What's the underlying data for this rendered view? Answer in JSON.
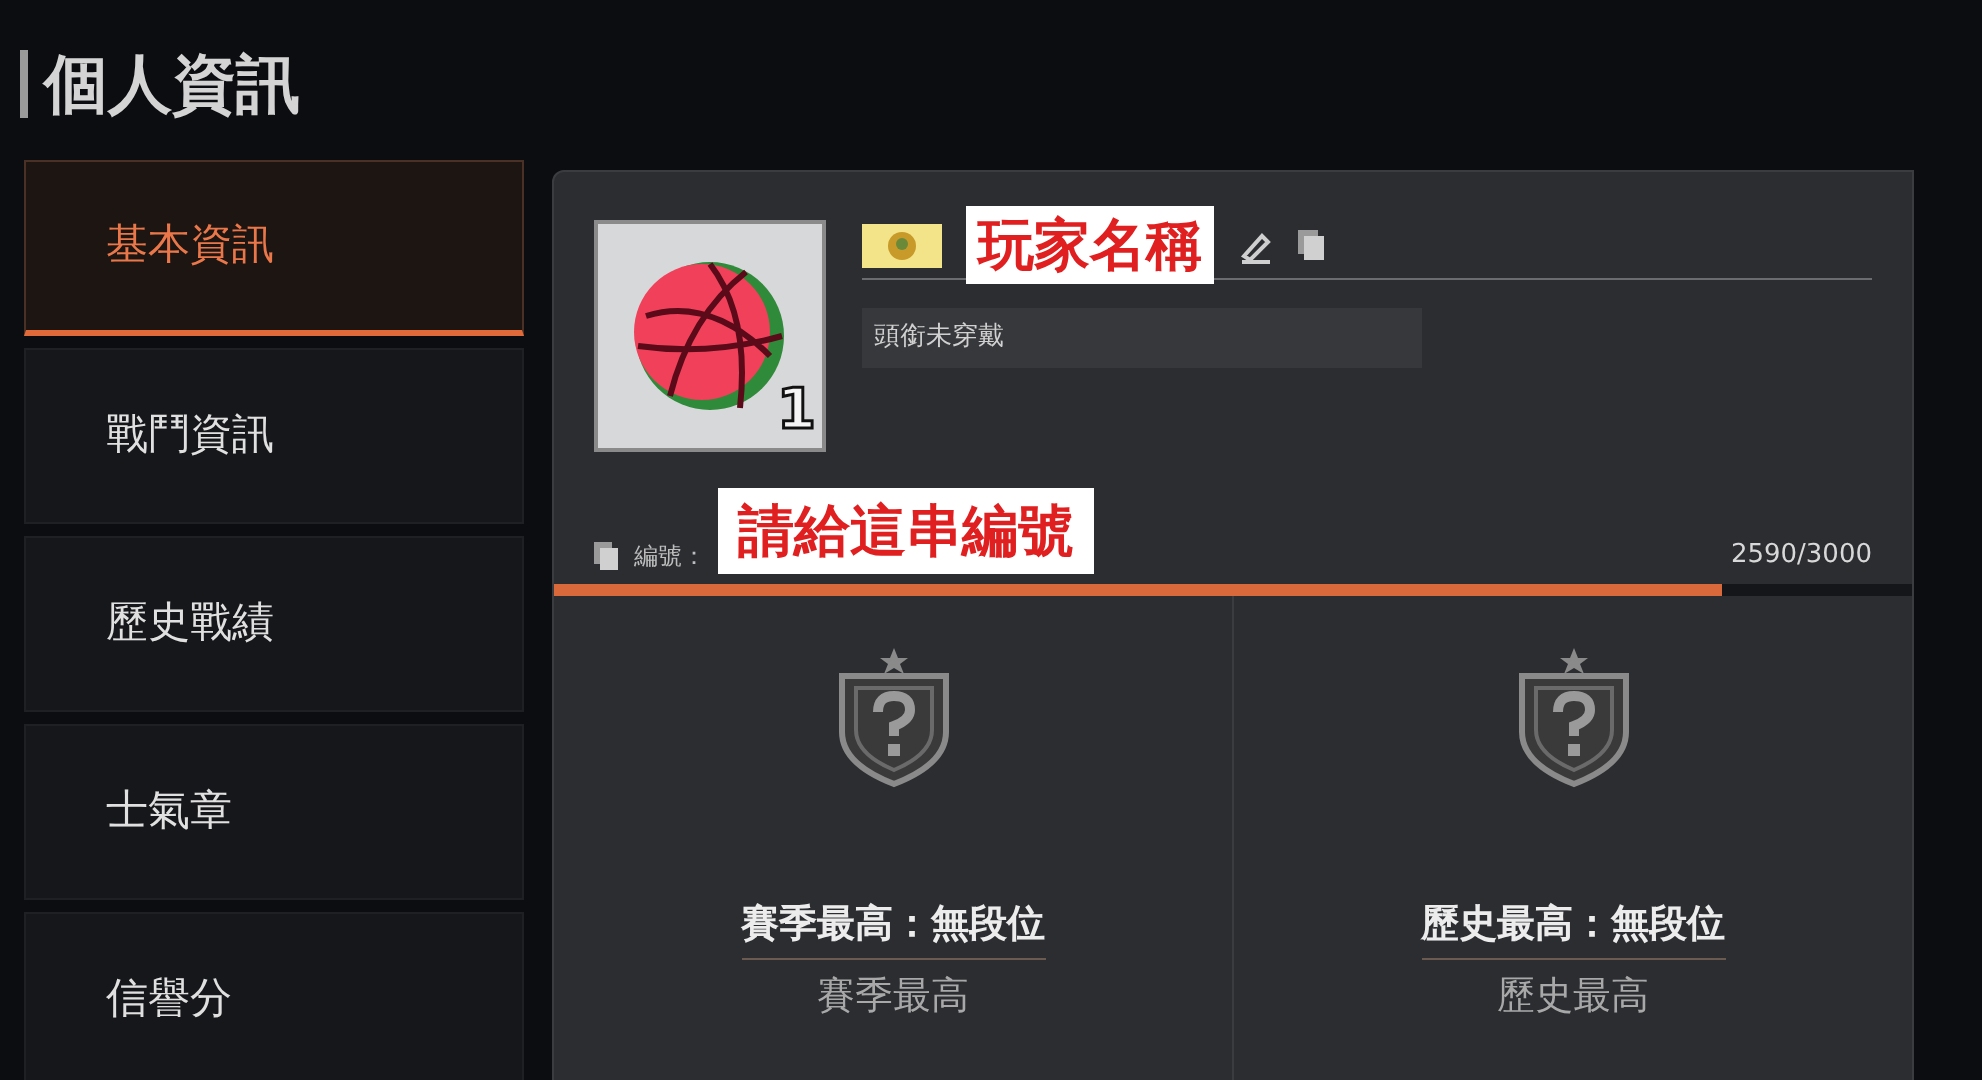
{
  "page_title": "個人資訊",
  "sidebar": {
    "items": [
      {
        "label": "基本資訊",
        "selected": true
      },
      {
        "label": "戰鬥資訊",
        "selected": false
      },
      {
        "label": "歷史戰績",
        "selected": false
      },
      {
        "label": "士氣章",
        "selected": false
      },
      {
        "label": "信譽分",
        "selected": false
      }
    ]
  },
  "profile": {
    "avatar_number": "1",
    "player_name_label": "玩家名稱",
    "headgear": "頭銜未穿戴",
    "id_label": "編號：",
    "id_label_annotation": "請給這串編號",
    "exp_reading": "2590/3000",
    "level": 0.86
  },
  "ranks": [
    {
      "title": "賽季最高：無段位",
      "subtitle": "賽季最高"
    },
    {
      "title": "歷史最高：無段位",
      "subtitle": "歷史最高"
    }
  ]
}
